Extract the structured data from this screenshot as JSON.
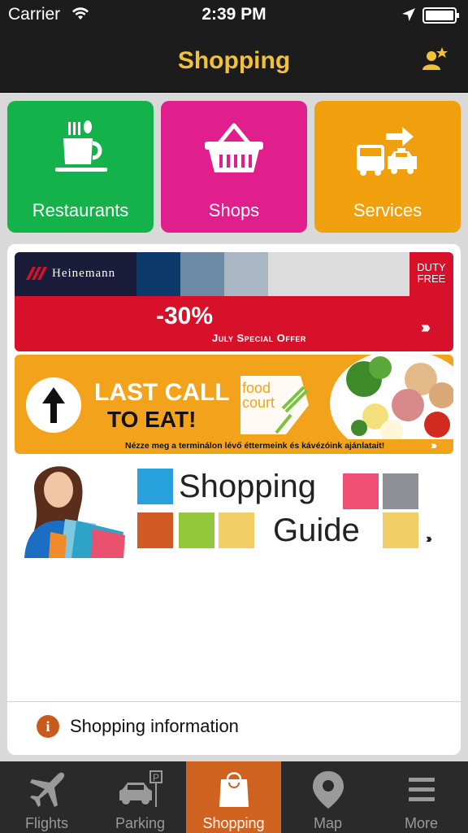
{
  "status_bar": {
    "carrier": "Carrier",
    "time": "2:39 PM"
  },
  "nav": {
    "title": "Shopping"
  },
  "categories": [
    {
      "label": "Restaurants",
      "color": "#13b24a",
      "icon": "coffee-cup-icon"
    },
    {
      "label": "Shops",
      "color": "#e01e8c",
      "icon": "shopping-basket-icon"
    },
    {
      "label": "Services",
      "color": "#f0a00c",
      "icon": "bus-taxi-icon"
    }
  ],
  "banners": {
    "heinemann": {
      "brand": "Heinemann",
      "duty_free_line1": "DUTY",
      "duty_free_line2": "FREE",
      "discount": "-30%",
      "offer": "July Special Offer"
    },
    "food_court": {
      "line1": "LAST CALL",
      "line2": "TO EAT!",
      "logo_line1": "food",
      "logo_line2": "court",
      "subtitle": "Nézze meg a terminálon lévő éttermeink és kávézóink ajánlatait!"
    },
    "shopping_guide": {
      "line1": "Shopping",
      "line2": "Guide"
    }
  },
  "info": {
    "label": "Shopping information"
  },
  "tabs": [
    {
      "label": "Flights",
      "icon": "airplane-icon",
      "active": false
    },
    {
      "label": "Parking",
      "icon": "parking-car-icon",
      "active": false
    },
    {
      "label": "Shopping",
      "icon": "shopping-bag-icon",
      "active": true
    },
    {
      "label": "Map",
      "icon": "map-pin-icon",
      "active": false
    },
    {
      "label": "More",
      "icon": "menu-icon",
      "active": false
    }
  ],
  "colors": {
    "accent": "#f2c13c",
    "active_tab": "#d0621f",
    "heinemann_red": "#d8112a",
    "food_orange": "#f3a31b"
  }
}
